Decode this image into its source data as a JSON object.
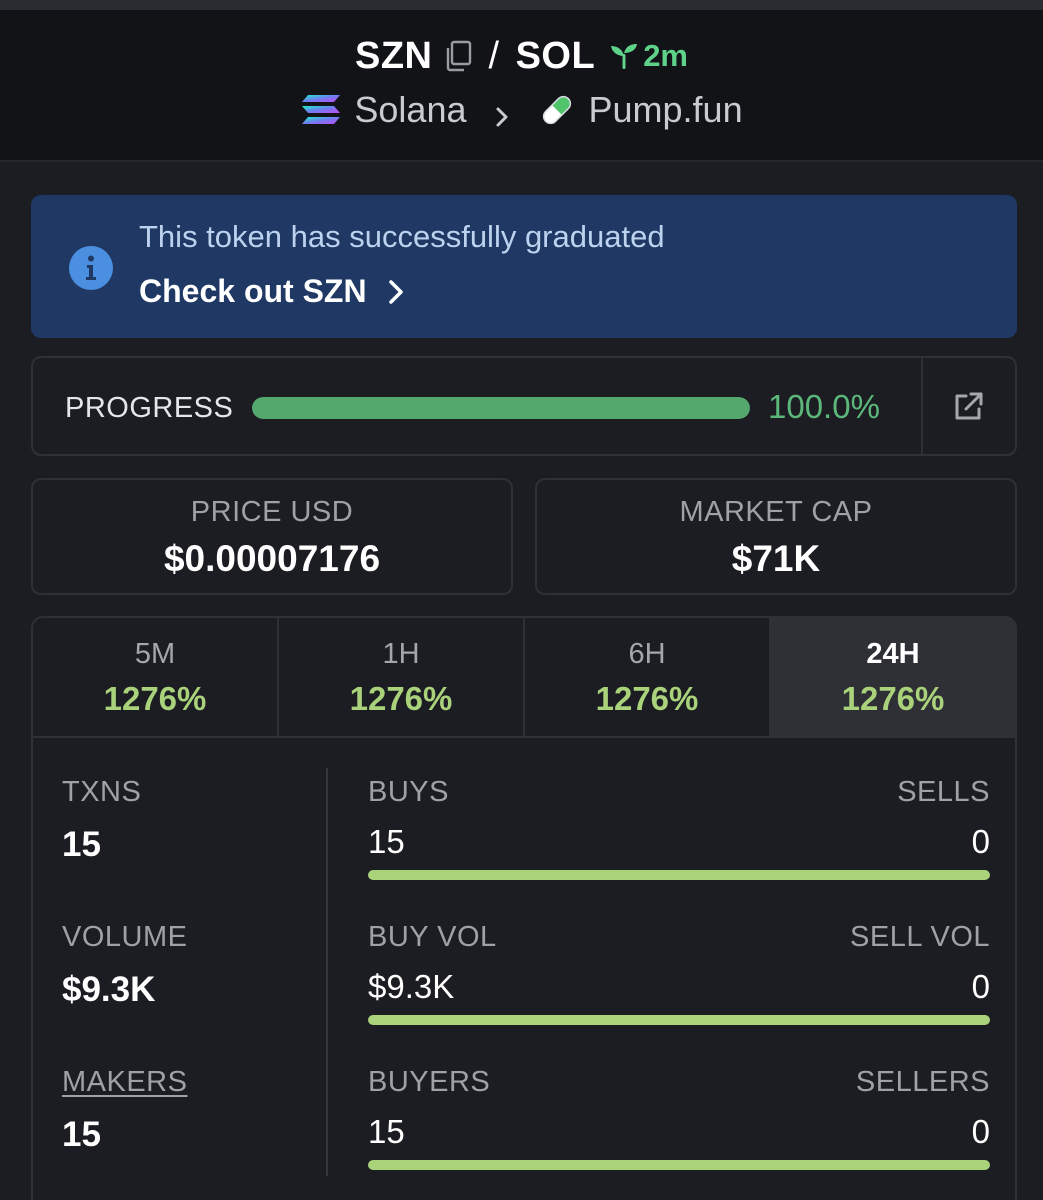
{
  "header": {
    "base_symbol": "SZN",
    "separator": "/",
    "quote_symbol": "SOL",
    "age": "2m",
    "chain": "Solana",
    "dex": "Pump.fun"
  },
  "banner": {
    "message": "This token has successfully graduated",
    "link_label": "Check out SZN"
  },
  "progress": {
    "label": "PROGRESS",
    "percent_text": "100.0%",
    "fraction": 1.0
  },
  "price": {
    "label": "PRICE USD",
    "value": "$0.00007176"
  },
  "market_cap": {
    "label": "MARKET CAP",
    "value": "$71K"
  },
  "timeframes": [
    {
      "name": "5M",
      "change": "1276%"
    },
    {
      "name": "1H",
      "change": "1276%"
    },
    {
      "name": "6H",
      "change": "1276%"
    },
    {
      "name": "24H",
      "change": "1276%",
      "active": true
    }
  ],
  "stats": {
    "txns": {
      "label": "TXNS",
      "value": "15"
    },
    "volume": {
      "label": "VOLUME",
      "value": "$9.3K"
    },
    "makers": {
      "label": "MAKERS",
      "value": "15"
    },
    "buys_sells": {
      "left_label": "BUYS",
      "right_label": "SELLS",
      "left_value": "15",
      "right_value": "0",
      "buy_fraction": 1.0
    },
    "buyvol_sellvol": {
      "left_label": "BUY VOL",
      "right_label": "SELL VOL",
      "left_value": "$9.3K",
      "right_value": "0",
      "buy_fraction": 1.0
    },
    "buyers_sellers": {
      "left_label": "BUYERS",
      "right_label": "SELLERS",
      "left_value": "15",
      "right_value": "0",
      "buy_fraction": 1.0
    }
  },
  "colors": {
    "accent_green": "#5cb87a",
    "change_green": "#a9d27b",
    "banner_bg": "#1f3864",
    "info_blue": "#4a8fe0"
  },
  "icons": [
    "copy-icon",
    "sprout-icon",
    "solana-logo-icon",
    "chevron-right-icon",
    "pill-icon",
    "info-icon",
    "external-link-icon"
  ]
}
